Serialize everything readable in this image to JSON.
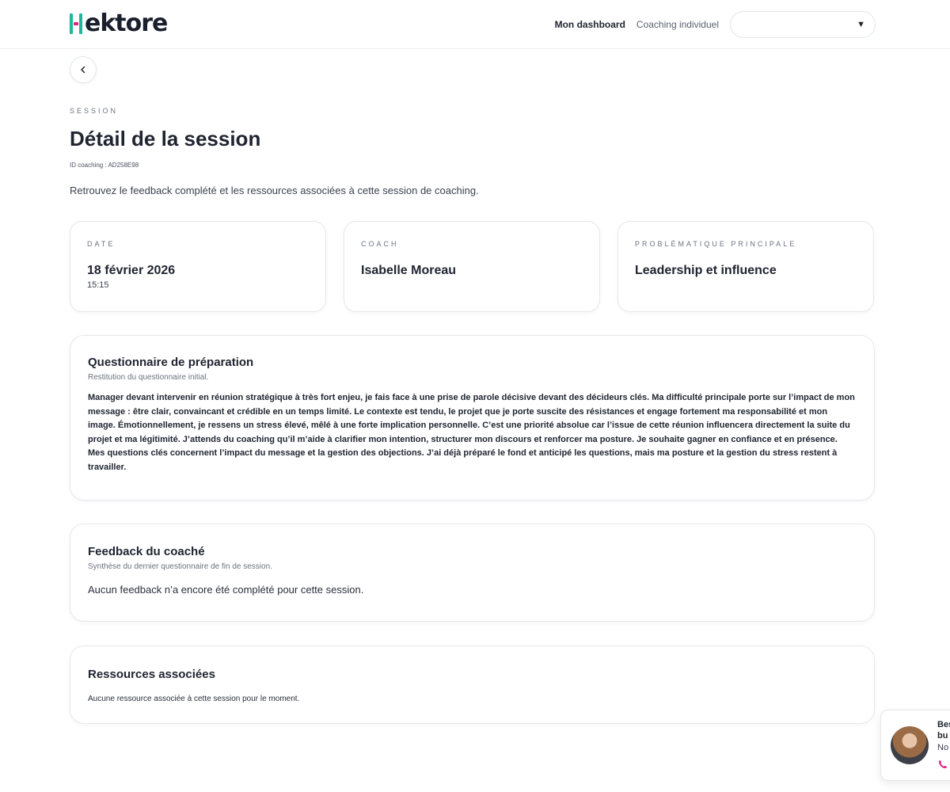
{
  "header": {
    "brand_text": "ektore",
    "brand_full": "Hektore",
    "nav": {
      "dashboard": "Mon dashboard",
      "coaching": "Coaching individuel"
    },
    "select_value": ""
  },
  "page": {
    "eyebrow": "SESSION",
    "title": "Détail de la session",
    "coaching_id": "ID coaching : AD258E98",
    "intro": "Retrouvez le feedback complété et les ressources associées à cette session de coaching."
  },
  "info_cards": {
    "date": {
      "label": "DATE",
      "value": "18 février 2026",
      "time": "15:15"
    },
    "coach": {
      "label": "COACH",
      "value": "Isabelle Moreau"
    },
    "problem": {
      "label": "PROBLÉMATIQUE PRINCIPALE",
      "value": "Leadership et influence"
    }
  },
  "sections": {
    "questionnaire": {
      "title": "Questionnaire de préparation",
      "description": "Restitution du questionnaire initial.",
      "content": "Manager devant intervenir en réunion stratégique à très fort enjeu, je fais face à une prise de parole décisive devant des décideurs clés. Ma difficulté principale porte sur l’impact de mon message : être clair, convaincant et crédible en un temps limité. Le contexte est tendu, le projet que je porte suscite des résistances et engage fortement ma responsabilité et mon image. Émotionnellement, je ressens un stress élevé, mêlé à une forte implication personnelle. C’est une priorité absolue car l’issue de cette réunion influencera directement la suite du projet et ma légitimité. J’attends du coaching qu’il m’aide à clarifier mon intention, structurer mon discours et renforcer ma posture. Je souhaite gagner en confiance et en présence. Mes questions clés concernent l’impact du message et la gestion des objections. J’ai déjà préparé le fond et anticipé les questions, mais ma posture et la gestion du stress restent à travailler."
    },
    "feedback": {
      "title": "Feedback du coaché",
      "description": "Synthèse du dernier questionnaire de fin de session.",
      "content": "Aucun feedback n’a encore été complété pour cette session."
    },
    "resources": {
      "title": "Ressources associées",
      "content": "Aucune ressource associée à cette session pour le moment."
    }
  },
  "contact_widget": {
    "line1": "Bes",
    "line2": "bu",
    "line3": "No"
  },
  "colors": {
    "brand_green": "#1fb89a",
    "brand_pink": "#e0217a",
    "text_dark": "#1f2430"
  },
  "icons": {
    "back": "chevron-left-icon",
    "dropdown": "caret-down-icon",
    "phone": "phone-icon"
  }
}
